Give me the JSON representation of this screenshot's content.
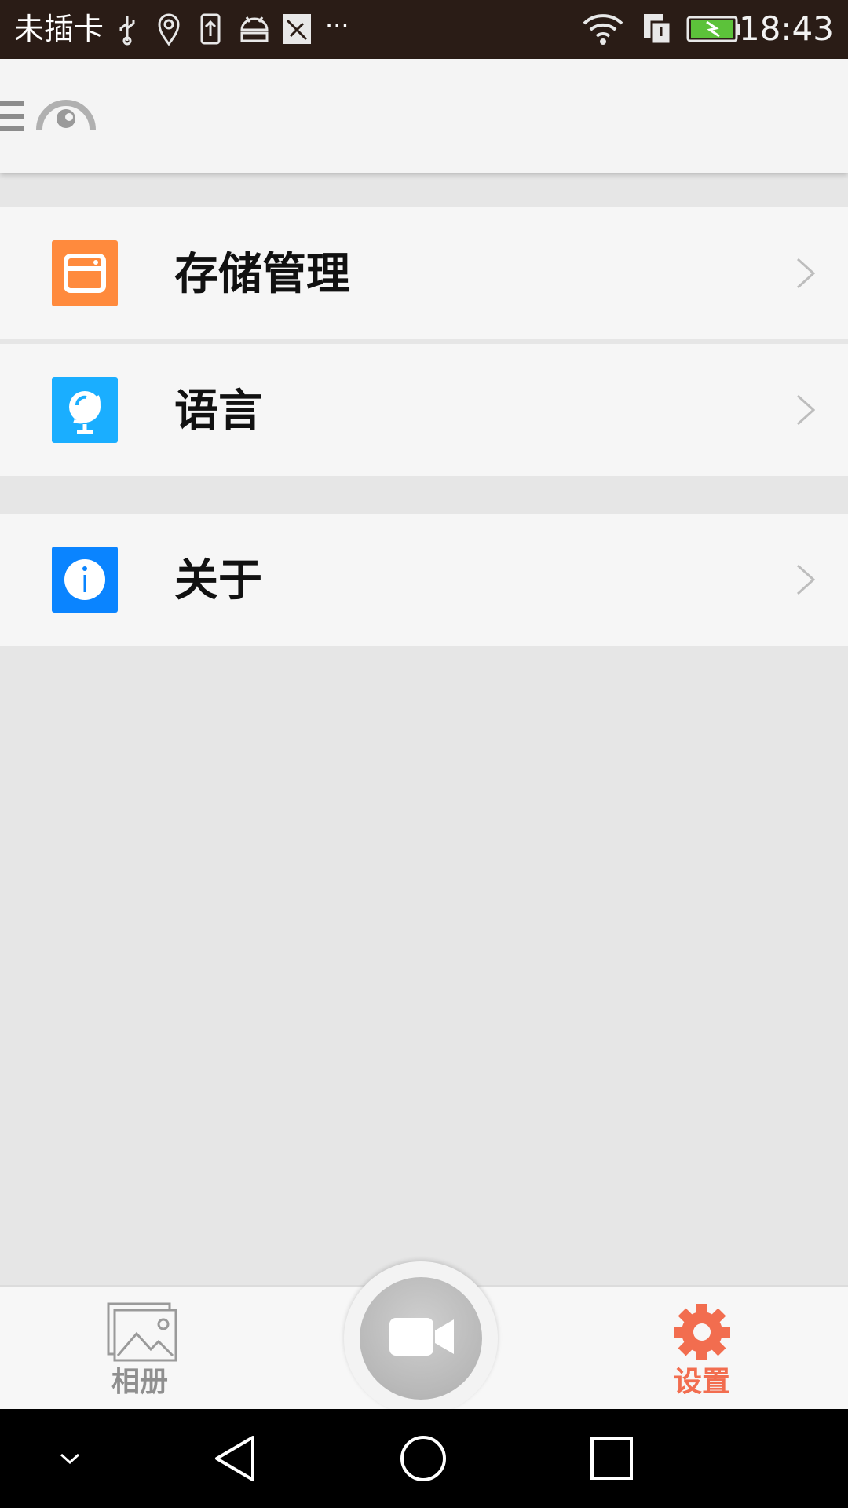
{
  "status_bar": {
    "carrier": "未插卡",
    "time": "18:43",
    "icons": [
      "usb-icon",
      "location-icon",
      "upload-icon",
      "android-debug-icon",
      "sim-blocked-icon",
      "more-dots-icon",
      "wifi-icon",
      "dual-sim-icon",
      "battery-charging-icon"
    ],
    "overflow_text": "···"
  },
  "header": {
    "icons": [
      "menu-icon",
      "app-logo-icon"
    ]
  },
  "settings": {
    "group1": [
      {
        "label": "存储管理",
        "icon": "storage-icon",
        "color": "#ff8a3d"
      },
      {
        "label": "语言",
        "icon": "globe-icon",
        "color": "#1aaeff"
      }
    ],
    "group2": [
      {
        "label": "关于",
        "icon": "info-icon",
        "color": "#0a84ff"
      }
    ]
  },
  "tabbar": {
    "album_label": "相册",
    "settings_label": "设置",
    "active_color": "#f26d4f",
    "inactive_color": "#8f8f8f",
    "record_icon": "video-camera-icon"
  },
  "navbar": {
    "icons": [
      "hide-keyboard-icon",
      "back-icon",
      "home-icon",
      "recents-icon"
    ]
  }
}
